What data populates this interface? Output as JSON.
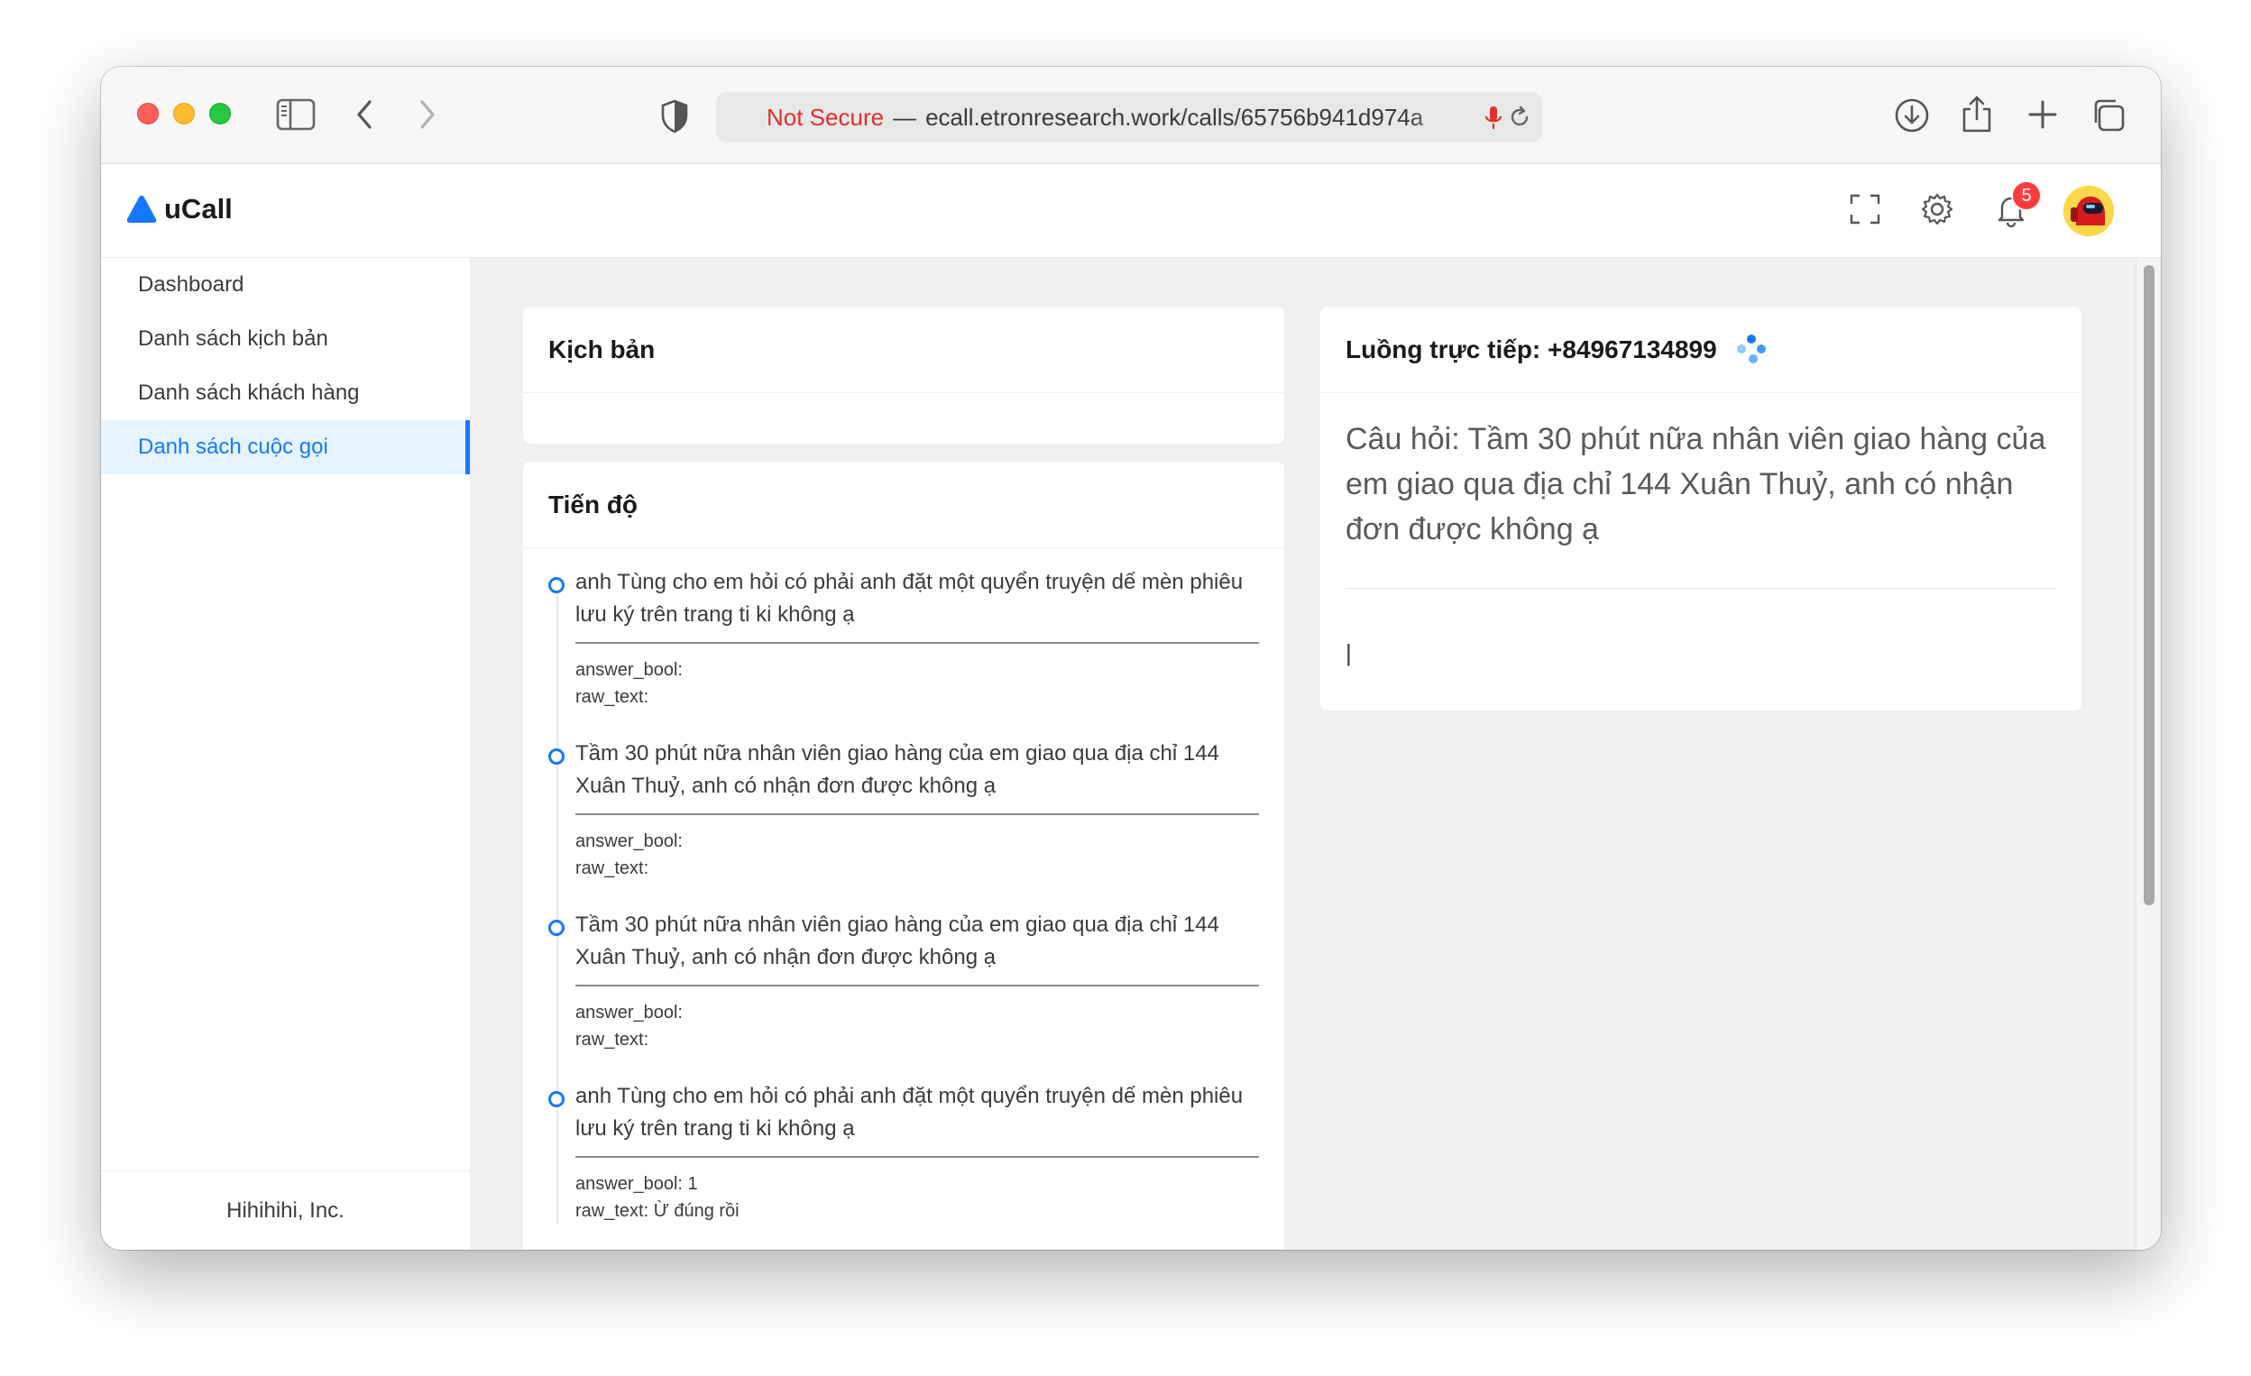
{
  "browser": {
    "url_not_secure": "Not Secure",
    "url_separator": "—",
    "url": "ecall.etronresearch.work/calls/65756b941d974a"
  },
  "app": {
    "name": "uCall",
    "notification_count": "5",
    "accent_color": "#1677ff"
  },
  "sidebar": {
    "items": [
      {
        "label": "Dashboard",
        "active": false
      },
      {
        "label": "Danh sách kịch bản",
        "active": false
      },
      {
        "label": "Danh sách khách hàng",
        "active": false
      },
      {
        "label": "Danh sách cuộc gọi",
        "active": true
      }
    ],
    "footer": "Hihihihi, Inc."
  },
  "script_card": {
    "title": "Kịch bản"
  },
  "progress_card": {
    "title": "Tiến độ",
    "items": [
      {
        "question": "anh Tùng cho em hỏi có phải anh đặt một quyển truyện dế mèn phiêu lưu ký trên trang ti ki không ạ",
        "answer_bool": "answer_bool:",
        "raw_text": "raw_text:"
      },
      {
        "question": "Tầm 30 phút nữa nhân viên giao hàng của em giao qua địa chỉ 144 Xuân Thuỷ, anh có nhận đơn được không ạ",
        "answer_bool": "answer_bool:",
        "raw_text": "raw_text:"
      },
      {
        "question": "Tầm 30 phút nữa nhân viên giao hàng của em giao qua địa chỉ 144 Xuân Thuỷ, anh có nhận đơn được không ạ",
        "answer_bool": "answer_bool:",
        "raw_text": "raw_text:"
      },
      {
        "question": "anh Tùng cho em hỏi có phải anh đặt một quyển truyện dế mèn phiêu lưu ký trên trang ti ki không ạ",
        "answer_bool": "answer_bool: 1",
        "raw_text": "raw_text: Ừ đúng rồi"
      }
    ]
  },
  "stream_card": {
    "title": "Luồng trực tiếp: +84967134899",
    "question": "Câu hỏi: Tầm 30 phút nữa nhân viên giao hàng của em giao qua địa chỉ 144 Xuân Thuỷ, anh có nhận đơn được không ạ",
    "cursor": "|"
  }
}
